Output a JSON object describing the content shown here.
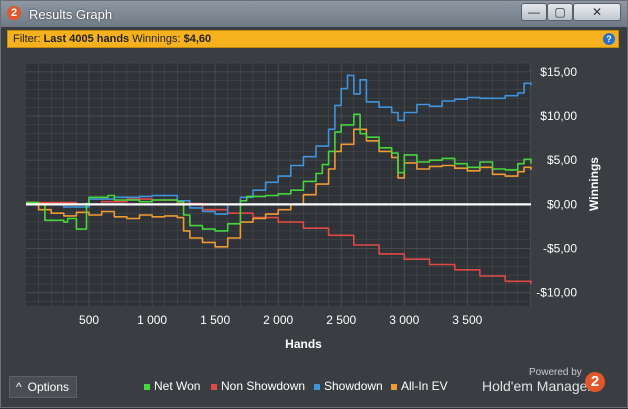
{
  "window": {
    "title": "Results Graph",
    "app_icon_glyph": "2",
    "buttons": {
      "minimize": "—",
      "maximize": "▢",
      "close": "✕"
    }
  },
  "filter": {
    "prefix": "Filter:",
    "hands_label": "Last 4005 hands",
    "winnings_label": "Winnings:",
    "winnings_value": "$4,60",
    "help_icon": "?"
  },
  "footer": {
    "options_label": "Options",
    "options_icon": "^",
    "powered_by": "Powered by",
    "brand_name": "Hold'em Manager",
    "brand_logo_glyph": "2"
  },
  "colors": {
    "net_won": "#46d63c",
    "non_showdown": "#e04a45",
    "showdown": "#3f94dd",
    "all_in_ev": "#f09a34",
    "plot_bg": "#2f3236",
    "grid": "#4b4f54",
    "zero_line": "#ffffff"
  },
  "chart_data": {
    "type": "line",
    "xlabel": "Hands",
    "ylabel": "Winnings",
    "xlim": [
      0,
      4005
    ],
    "ylim": [
      -11.5,
      16
    ],
    "x_ticks": [
      500,
      1000,
      1500,
      2000,
      2500,
      3000,
      3500
    ],
    "x_tick_labels": [
      "500",
      "1 000",
      "1 500",
      "2 000",
      "2 500",
      "3 000",
      "3 500"
    ],
    "y_ticks": [
      15,
      10,
      5,
      0,
      -5,
      -10
    ],
    "y_tick_labels": [
      "$15,00",
      "$10,00",
      "$5,00",
      "$0,00",
      "-$5,00",
      "-$10,00"
    ],
    "grid": true,
    "legend_position": "bottom",
    "series": [
      {
        "name": "Net Won",
        "color_key": "net_won",
        "x": [
          0,
          100,
          150,
          300,
          330,
          400,
          480,
          500,
          650,
          700,
          900,
          1000,
          1200,
          1250,
          1300,
          1400,
          1500,
          1600,
          1700,
          1750,
          1900,
          2000,
          2100,
          2200,
          2300,
          2350,
          2400,
          2450,
          2500,
          2600,
          2650,
          2700,
          2800,
          2900,
          2950,
          3000,
          3100,
          3200,
          3300,
          3400,
          3500,
          3600,
          3700,
          3800,
          3900,
          3950,
          4005
        ],
        "y": [
          0.2,
          0.0,
          -1.8,
          -2.0,
          -1.6,
          -2.8,
          0.1,
          0.8,
          1.0,
          0.5,
          0.3,
          0.5,
          0.3,
          -1.2,
          -2.4,
          -2.8,
          -3.0,
          -2.2,
          0.4,
          0.9,
          1.0,
          1.2,
          1.6,
          2.6,
          3.5,
          4.5,
          6.0,
          8.2,
          9.0,
          10.2,
          8.0,
          7.6,
          6.4,
          5.8,
          3.6,
          5.6,
          4.8,
          5.0,
          5.2,
          4.6,
          4.2,
          4.8,
          4.0,
          3.9,
          4.6,
          5.1,
          4.6
        ]
      },
      {
        "name": "Non Showdown",
        "color_key": "non_showdown",
        "x": [
          0,
          200,
          400,
          600,
          800,
          1000,
          1200,
          1400,
          1600,
          1800,
          2000,
          2200,
          2400,
          2600,
          2800,
          3000,
          3200,
          3400,
          3600,
          3800,
          4005
        ],
        "y": [
          0.2,
          0.2,
          0.0,
          0.3,
          0.6,
          0.5,
          0.1,
          -0.6,
          -1.0,
          -1.5,
          -2.0,
          -2.7,
          -3.5,
          -4.6,
          -5.6,
          -6.2,
          -6.8,
          -7.4,
          -8.1,
          -8.7,
          -9.0
        ]
      },
      {
        "name": "Showdown",
        "color_key": "showdown",
        "x": [
          0,
          300,
          500,
          700,
          900,
          1000,
          1200,
          1300,
          1400,
          1500,
          1600,
          1700,
          1800,
          1900,
          2000,
          2100,
          2200,
          2300,
          2400,
          2450,
          2500,
          2550,
          2600,
          2650,
          2700,
          2800,
          2900,
          2950,
          3000,
          3100,
          3200,
          3300,
          3400,
          3500,
          3600,
          3700,
          3800,
          3900,
          3950,
          4005
        ],
        "y": [
          0.0,
          -0.3,
          0.6,
          0.8,
          0.9,
          1.0,
          0.4,
          -0.4,
          -0.8,
          -1.1,
          0.0,
          0.8,
          1.6,
          2.5,
          3.2,
          4.4,
          5.4,
          6.6,
          8.5,
          11.2,
          13.1,
          14.6,
          12.5,
          14.1,
          11.6,
          11.0,
          10.4,
          9.5,
          10.4,
          11.3,
          11.1,
          11.7,
          11.9,
          12.1,
          12.0,
          12.0,
          12.3,
          12.6,
          13.7,
          13.5
        ]
      },
      {
        "name": "All-In EV",
        "color_key": "all_in_ev",
        "x": [
          0,
          100,
          200,
          300,
          400,
          500,
          600,
          700,
          800,
          900,
          1000,
          1100,
          1200,
          1250,
          1300,
          1400,
          1500,
          1600,
          1700,
          1800,
          1900,
          2000,
          2100,
          2200,
          2300,
          2400,
          2450,
          2500,
          2600,
          2700,
          2800,
          2900,
          2950,
          3000,
          3100,
          3200,
          3300,
          3400,
          3500,
          3600,
          3700,
          3800,
          3900,
          3950,
          4005
        ],
        "y": [
          0.2,
          -0.6,
          -1.0,
          -1.3,
          -0.9,
          -1.2,
          -0.8,
          -1.4,
          -1.6,
          -1.2,
          -1.4,
          -1.3,
          -1.5,
          -3.0,
          -3.8,
          -4.3,
          -4.8,
          -3.8,
          -2.0,
          -1.6,
          -1.1,
          -0.6,
          0.0,
          1.1,
          2.3,
          4.0,
          6.0,
          6.8,
          8.5,
          7.2,
          6.0,
          5.3,
          3.0,
          4.7,
          4.0,
          4.3,
          4.4,
          4.1,
          3.8,
          4.2,
          3.4,
          3.2,
          3.7,
          4.2,
          3.9
        ]
      }
    ]
  }
}
